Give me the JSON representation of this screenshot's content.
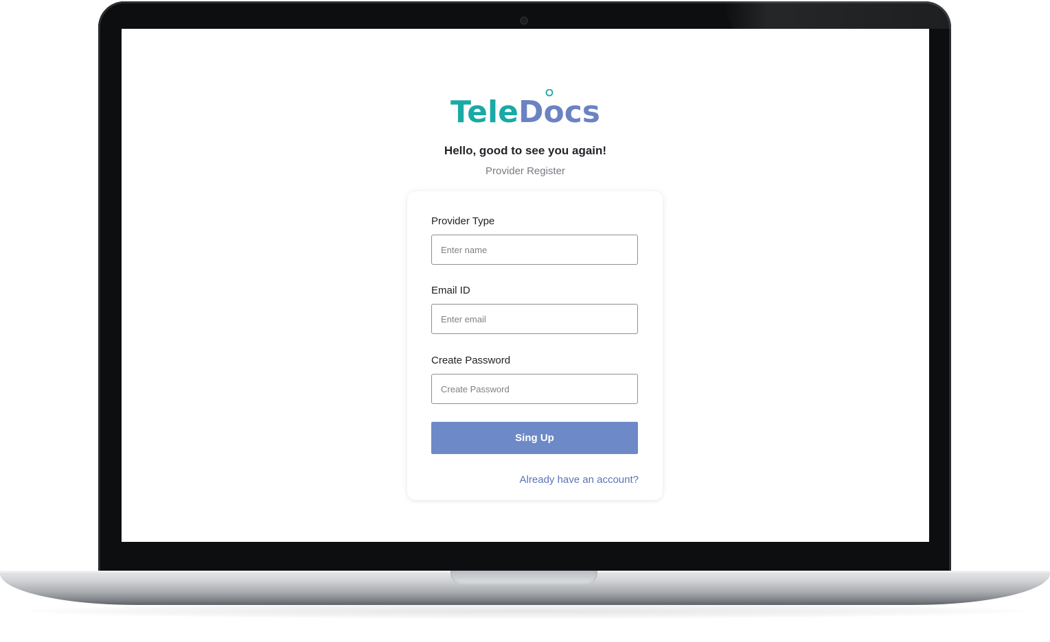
{
  "app": {
    "logo_part1": "Tele",
    "logo_part2": "Docs",
    "logo_colors": {
      "tele": "#1aa9a5",
      "docs": "#6b83c2"
    }
  },
  "header": {
    "greeting": "Hello, good to see you again!",
    "subtitle": "Provider Register"
  },
  "form": {
    "provider_type": {
      "label": "Provider Type",
      "placeholder": "Enter name"
    },
    "email": {
      "label": "Email ID",
      "placeholder": "Enter email"
    },
    "password": {
      "label": "Create Password",
      "placeholder": "Create Password"
    },
    "submit_label": "Sing Up",
    "login_link": "Already have an account?"
  },
  "colors": {
    "accent": "#6d89c7",
    "link": "#5b73b8"
  }
}
